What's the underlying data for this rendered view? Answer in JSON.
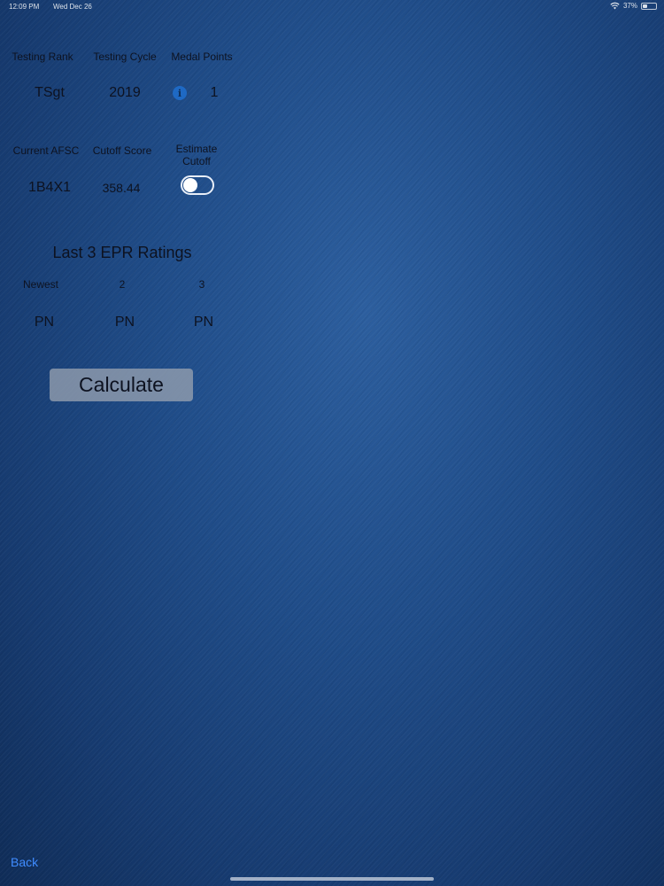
{
  "status_bar": {
    "time": "12:09 PM",
    "date": "Wed Dec 26",
    "battery": "37%",
    "battery_level": 0.37
  },
  "testing": {
    "rank_label": "Testing Rank",
    "cycle_label": "Testing Cycle",
    "medal_label": "Medal Points",
    "rank_value": "TSgt",
    "cycle_value": "2019",
    "medal_value": "1"
  },
  "afsc": {
    "afsc_label": "Current AFSC",
    "cutoff_label": "Cutoff Score",
    "estimate_label_line1": "Estimate",
    "estimate_label_line2": "Cutoff",
    "afsc_value": "1B4X1",
    "cutoff_value": "358.44",
    "estimate_on": false
  },
  "epr": {
    "title": "Last 3 EPR Ratings",
    "headers": [
      "Newest",
      "2",
      "3"
    ],
    "values": [
      "PN",
      "PN",
      "PN"
    ]
  },
  "calculate_label": "Calculate",
  "back_label": "Back",
  "colors": {
    "background": "#1f4c88",
    "accent": "#3f8cff",
    "toggle_border": "#e8eef8",
    "button": "#969faf"
  },
  "icons": {
    "info": "info-icon",
    "wifi": "wifi-icon",
    "battery": "battery-icon"
  }
}
